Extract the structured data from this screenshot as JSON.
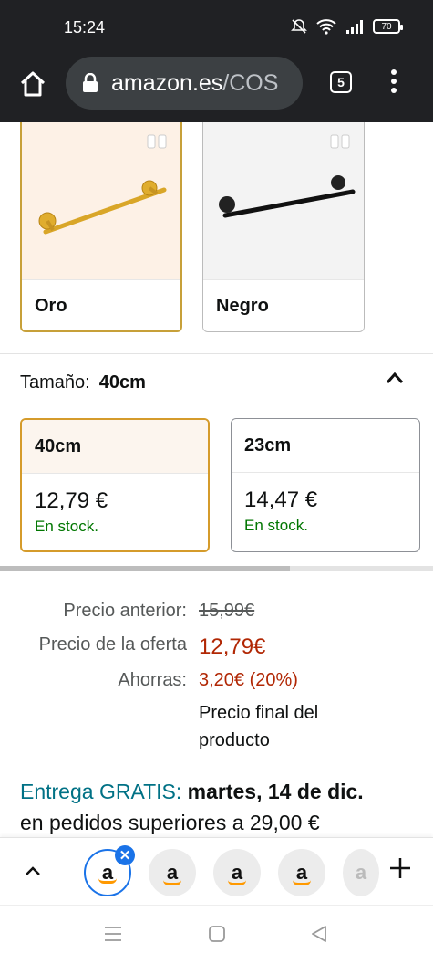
{
  "status_bar": {
    "time": "15:24",
    "battery": "70",
    "icons": [
      "mute-icon",
      "wifi-icon",
      "signal-icon",
      "battery-icon"
    ]
  },
  "browser": {
    "url_host": "amazon.es",
    "url_path": "/COS",
    "tab_count": "5"
  },
  "colors": {
    "options": [
      {
        "label": "Oro",
        "selected": true
      },
      {
        "label": "Negro",
        "selected": false
      }
    ]
  },
  "size": {
    "label": "Tamaño:",
    "selected": "40cm",
    "options": [
      {
        "name": "40cm",
        "price": "12,79 €",
        "stock": "En stock.",
        "selected": true
      },
      {
        "name": "23cm",
        "price": "14,47 €",
        "stock": "En stock.",
        "selected": false
      }
    ]
  },
  "pricing": {
    "previous_label": "Precio anterior:",
    "previous_value": "15,99€",
    "offer_label": "Precio de la oferta",
    "offer_value": "12,79€",
    "savings_label": "Ahorras:",
    "savings_value": "3,20€ (20%)",
    "final_note_1": "Precio final del",
    "final_note_2": "producto"
  },
  "delivery": {
    "prefix": "Entrega GRATIS:",
    "date": "martes, 14 de dic.",
    "condition": "en pedidos superiores a 29,00 €"
  },
  "bubbles": {
    "letter": "a"
  },
  "accent": {
    "gold": "#c7a039",
    "price_red": "#b12704",
    "stock_green": "#007600",
    "link_teal": "#007185",
    "chrome_blue": "#1a73e8"
  }
}
